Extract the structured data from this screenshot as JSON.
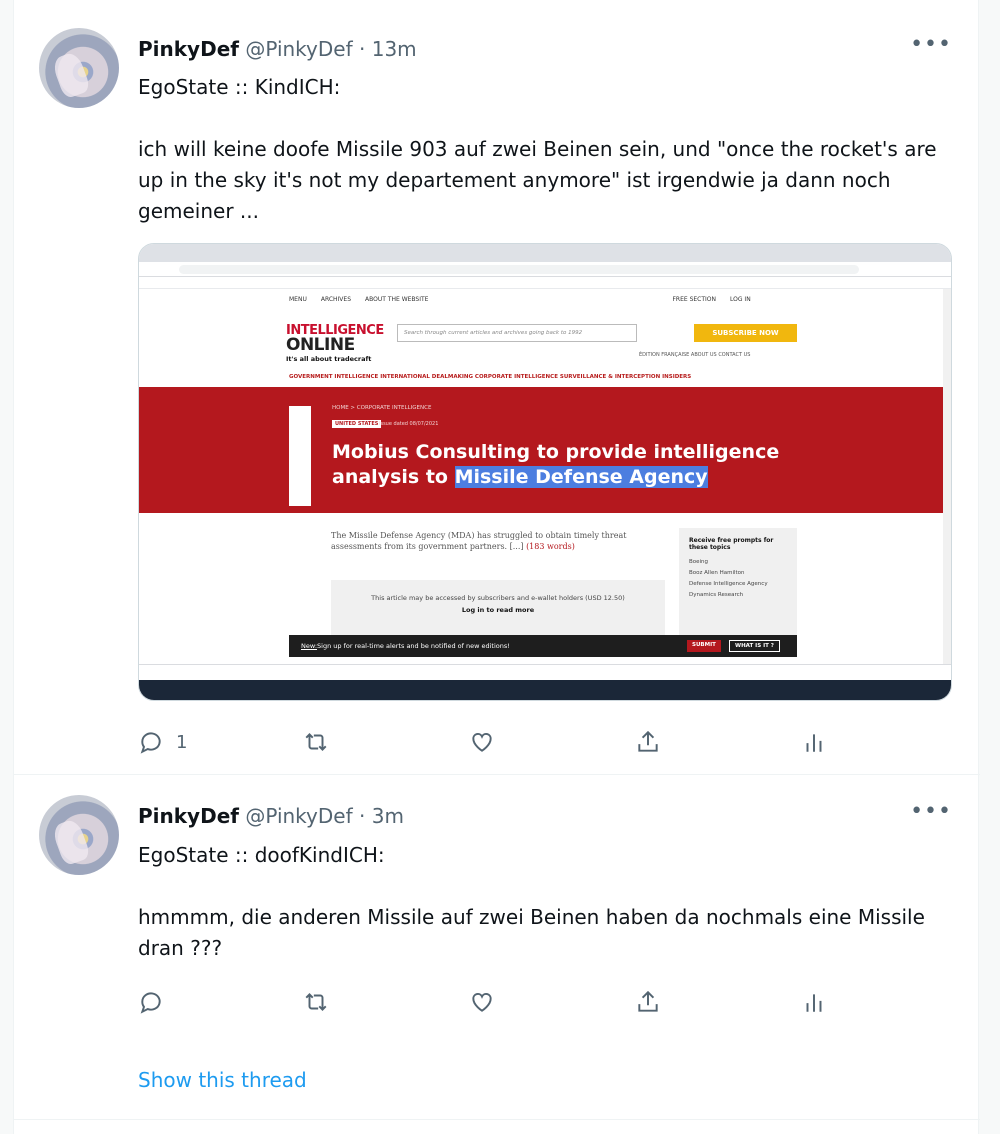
{
  "tweets": [
    {
      "name": "PinkyDef",
      "handle": "@PinkyDef",
      "separator": "·",
      "time": "13m",
      "more": "•••",
      "text": "EgoState :: KindICH:\n\nich will keine doofe Missile 903 auf zwei Beinen sein, und \"once the rocket's are up in the sky it's not my departement anymore\" ist irgendwie ja dann noch gemeiner ...",
      "reply_count": "1",
      "media": {
        "nav_menu": "MENU",
        "nav_archives": "ARCHIVES",
        "nav_about": "ABOUT THE WEBSITE",
        "free_section": "FREE SECTION",
        "login": "LOG IN",
        "logo_line1": "INTELLIGENCE",
        "logo_line2": "ONLINE",
        "logo_tagline": "It's all about tradecraft",
        "search_placeholder": "Search through current articles and archives going back to 1992",
        "subscribe": "SUBSCRIBE NOW",
        "edition_links": "ÉDITION FRANÇAISE   ABOUT US   CONTACT US",
        "categories": "GOVERNMENT INTELLIGENCE   INTERNATIONAL DEALMAKING   CORPORATE INTELLIGENCE   SURVEILLANCE & INTERCEPTION   INSIDERS",
        "breadcrumb": "HOME  >  CORPORATE INTELLIGENCE",
        "country_tag": "UNITED STATES",
        "issue_date": "Issue dated 08/07/2021",
        "headline_part1": "Mobius Consulting to provide intelligence analysis to ",
        "headline_highlight": "Missile Defense Agency",
        "lead_text": "The Missile Defense Agency (MDA) has struggled to obtain timely threat assessments from its government partners. [...] ",
        "lead_words": "(183 words)",
        "paywall_text": "This article may be accessed by subscribers and e-wallet holders (USD 12.50)",
        "paywall_login": "Log in to read more",
        "prompts_heading": "Receive free prompts for these topics",
        "prompt_1": "Boeing",
        "prompt_2": "Booz Allen Hamilton",
        "prompt_3": "Defense Intelligence Agency",
        "prompt_4": "Dynamics Research",
        "banner_new": "New:",
        "banner_text": " Sign up for real-time alerts and be notified of new editions!",
        "banner_submit": "SUBMIT",
        "banner_what": "WHAT IS IT ?"
      }
    },
    {
      "name": "PinkyDef",
      "handle": "@PinkyDef",
      "separator": "·",
      "time": "3m",
      "more": "•••",
      "text": "EgoState :: doofKindICH:\n\nhmmmm, die anderen Missile auf zwei Beinen haben da nochmals eine Missile dran ???",
      "show_thread": "Show this thread"
    }
  ],
  "icons": {
    "reply": "reply-icon",
    "retweet": "retweet-icon",
    "like": "heart-icon",
    "share": "share-icon",
    "analytics": "analytics-icon"
  },
  "colors": {
    "link": "#1d9bf0",
    "secondary_text": "#536471",
    "primary_text": "#0f1419",
    "headline_bg": "#b4181e"
  }
}
